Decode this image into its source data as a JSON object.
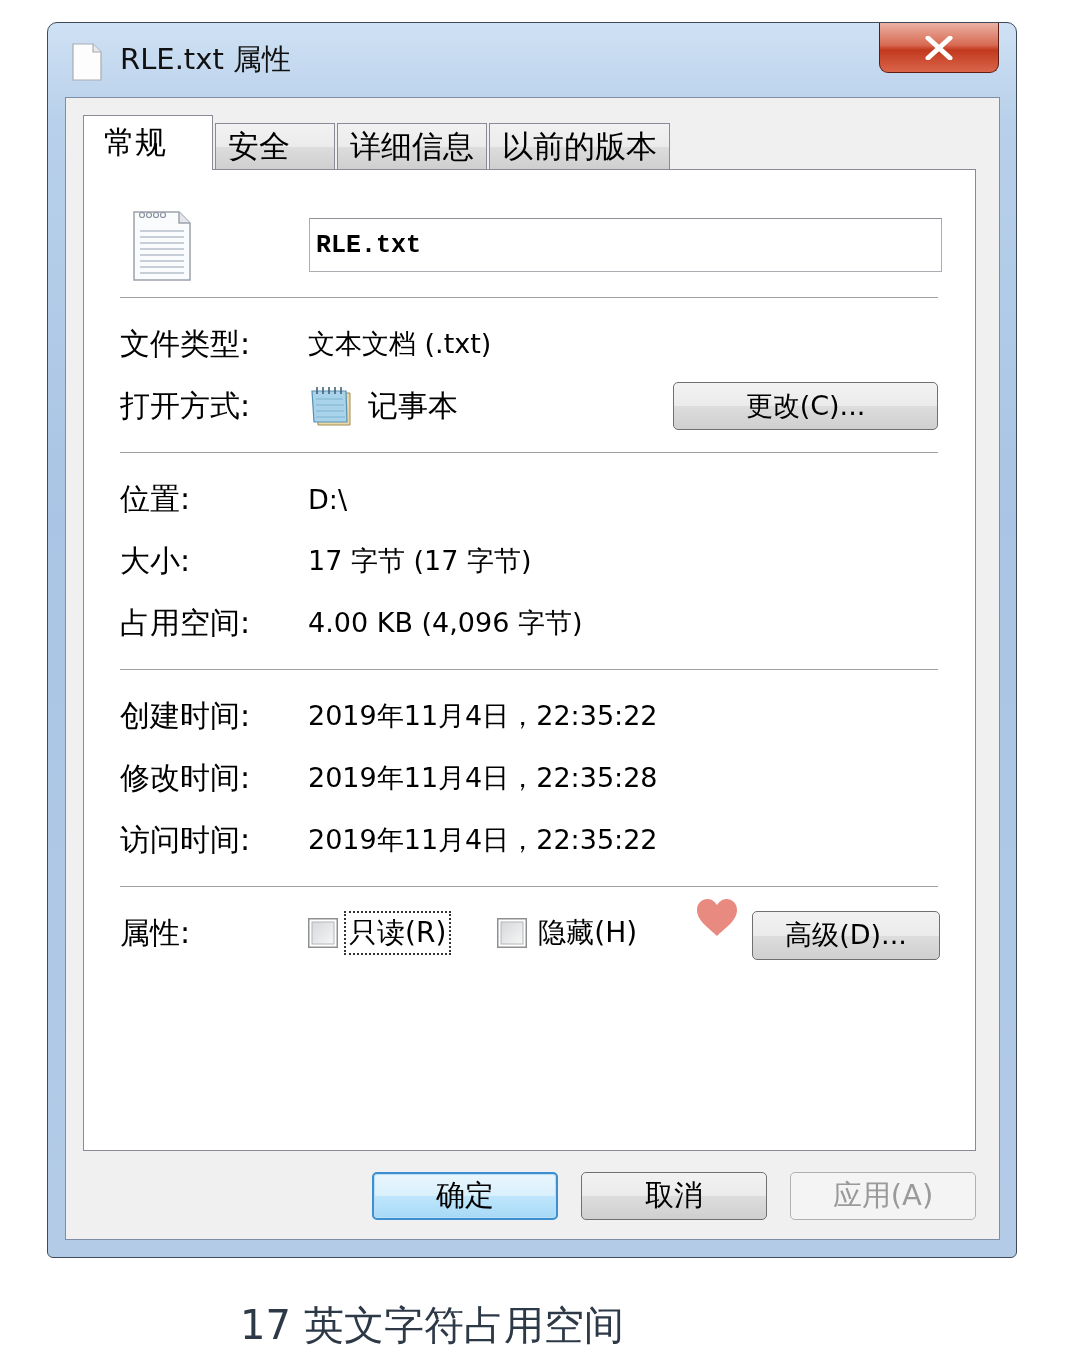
{
  "window": {
    "title": "RLE.txt 属性"
  },
  "tabs": [
    {
      "label": "常规",
      "selected": true
    },
    {
      "label": "安全",
      "selected": false
    },
    {
      "label": "详细信息",
      "selected": false
    },
    {
      "label": "以前的版本",
      "selected": false
    }
  ],
  "file_name": {
    "value": "RLE.txt"
  },
  "sections": [
    {
      "rows": [
        {
          "kind": "text",
          "label": "文件类型:",
          "value": "文本文档 (.txt)"
        },
        {
          "kind": "app",
          "label": "打开方式:",
          "value": "记事本",
          "button": "更改(C)..."
        }
      ]
    },
    {
      "rows": [
        {
          "kind": "text",
          "label": "位置:",
          "value": "D:\\"
        },
        {
          "kind": "text",
          "label": "大小:",
          "value": "17 字节 (17 字节)"
        },
        {
          "kind": "text",
          "label": "占用空间:",
          "value": "4.00 KB (4,096 字节)"
        }
      ]
    },
    {
      "rows": [
        {
          "kind": "text",
          "label": "创建时间:",
          "value": "2019年11月4日，22:35:22"
        },
        {
          "kind": "text",
          "label": "修改时间:",
          "value": "2019年11月4日，22:35:28"
        },
        {
          "kind": "text",
          "label": "访问时间:",
          "value": "2019年11月4日，22:35:22"
        }
      ]
    }
  ],
  "attributes": {
    "label": "属性:",
    "checkboxes": [
      {
        "label": "只读(R)",
        "checked": false,
        "focused": true
      },
      {
        "label": "隐藏(H)",
        "checked": false,
        "focused": false
      }
    ],
    "button": "高级(D)..."
  },
  "buttons": [
    {
      "label": "确定",
      "default": true,
      "disabled": false
    },
    {
      "label": "取消",
      "default": false,
      "disabled": false
    },
    {
      "label": "应用(A)",
      "default": false,
      "disabled": true
    }
  ],
  "caption": "17 英文字符占用空间"
}
